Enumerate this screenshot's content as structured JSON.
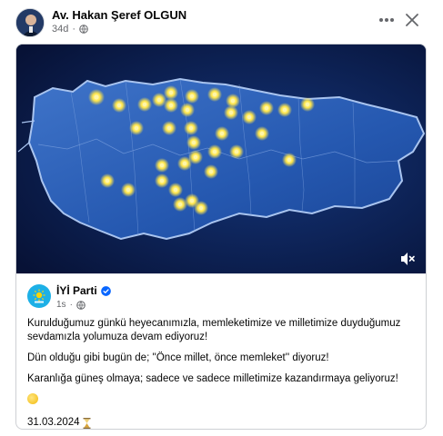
{
  "post": {
    "author": "Av. Hakan Şeref OLGUN",
    "time": "34d",
    "more_icon": "more-horizontal-icon",
    "close_icon": "close-icon"
  },
  "shared": {
    "page_name": "İYİ Parti",
    "page_time": "1s",
    "verified_icon": "verified-badge-icon",
    "paragraphs": [
      "Kurulduğumuz günkü heyecanımızla, memleketimize ve milletimize duyduğumuz sevdamızla yolumuza devam ediyoruz!",
      "Dün olduğu gibi bugün de; ''Önce millet, önce memleket'' diyoruz!",
      "Karanlığa güneş olmaya; sadece ve sadece milletimize kazandırmaya geliyoruz!"
    ],
    "date": "31.03.2024"
  },
  "video": {
    "description_icon": "muted-speaker-icon"
  },
  "colors": {
    "map_blue": "#1d4fa0",
    "star_yellow": "#ffe64a",
    "brand_blue": "#1db0e6"
  }
}
